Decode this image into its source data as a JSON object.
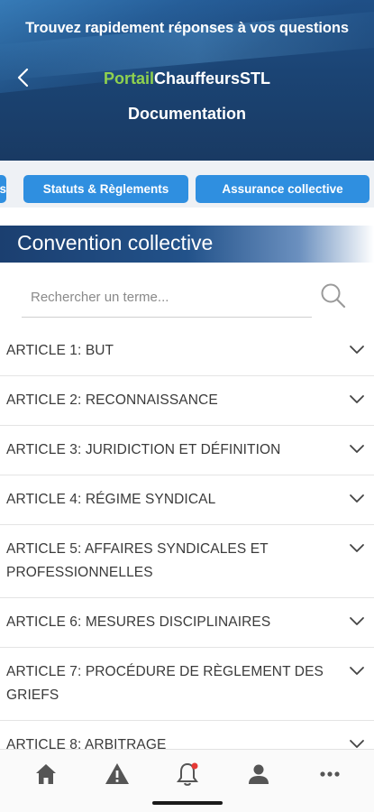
{
  "header": {
    "tagline": "Trouvez rapidement réponses à vos questions",
    "brand_part1": "Portail",
    "brand_part2": "ChauffeursSTL",
    "page_title": "Documentation",
    "brand_green": "#8fd14f"
  },
  "tabs": [
    "s",
    "Statuts & Règlements",
    "Assurance collective"
  ],
  "section": {
    "title": "Convention collective"
  },
  "search": {
    "placeholder": "Rechercher un terme..."
  },
  "articles": [
    "ARTICLE 1: BUT",
    "ARTICLE 2: RECONNAISSANCE",
    "ARTICLE 3: JURIDICTION ET DÉFINITION",
    "ARTICLE 4: RÉGIME SYNDICAL",
    "ARTICLE 5: AFFAIRES SYNDICALES ET PROFESSIONNELLES",
    "ARTICLE 6: MESURES DISCIPLINAIRES",
    "ARTICLE 7: PROCÉDURE DE RÈGLEMENT DES GRIEFS",
    "ARTICLE 8: ARBITRAGE"
  ],
  "bottom_nav": [
    "home-icon",
    "warning-icon",
    "notification-bell-icon",
    "profile-icon",
    "more-icon"
  ],
  "colors": {
    "tab_blue": "#2f8fe0",
    "header_navy": "#1b4474",
    "notification_dot": "#e53935"
  }
}
